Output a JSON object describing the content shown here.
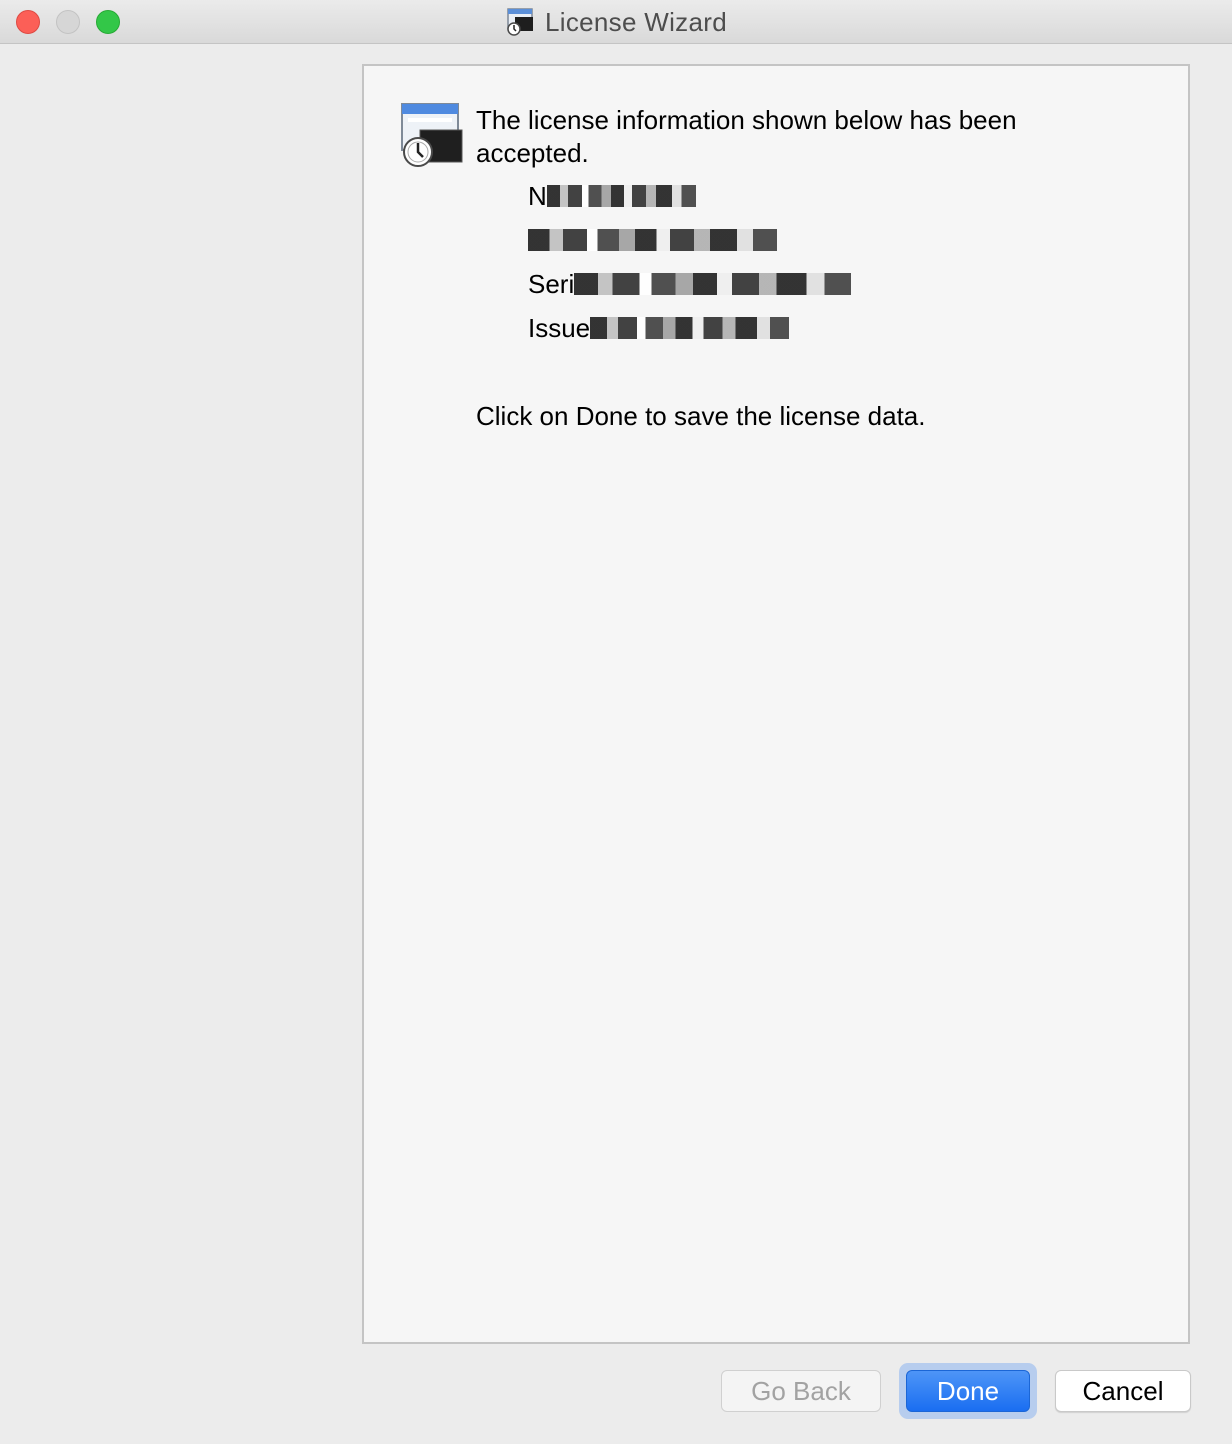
{
  "window": {
    "title": "License Wizard",
    "title_icon": "license-wizard-icon"
  },
  "traffic_lights": {
    "close_color": "#fc5f57",
    "minimize_color": "#d6d6d6",
    "zoom_color": "#33c748"
  },
  "content": {
    "app_icon": "license-wizard-icon",
    "headline": "The license information shown below has been accepted.",
    "info_lines": [
      {
        "label": "N",
        "redacted": true
      },
      {
        "label": "",
        "redacted": true
      },
      {
        "label": "Seri",
        "redacted": true
      },
      {
        "label": "Issue",
        "redacted": true
      }
    ],
    "instruction": "Click on Done to save the license data."
  },
  "buttons": {
    "go_back": "Go Back",
    "done": "Done",
    "cancel": "Cancel"
  },
  "colors": {
    "accent": "#1a6ef1",
    "panel_bg": "#f6f6f6",
    "window_bg": "#ececec"
  }
}
